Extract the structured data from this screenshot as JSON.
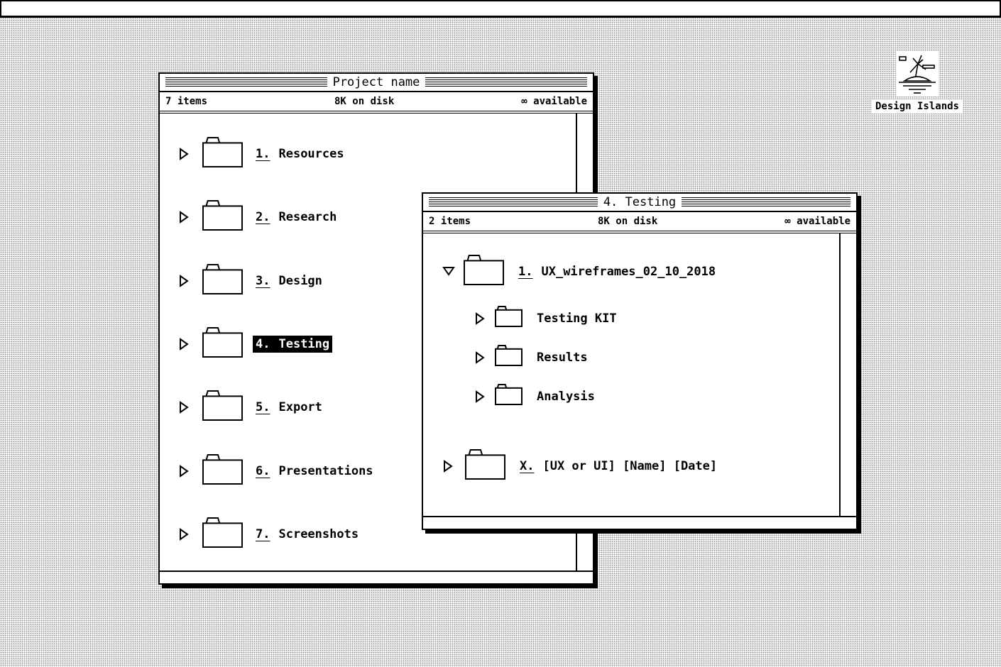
{
  "desktop": {
    "icon_label": "Design Islands",
    "icon_name": "island-icon"
  },
  "window_main": {
    "title": "Project name",
    "items_count": "7 items",
    "disk": "8K on disk",
    "available": "∞ available",
    "folders": [
      {
        "num": "1.",
        "name": "Resources"
      },
      {
        "num": "2.",
        "name": "Research"
      },
      {
        "num": "3.",
        "name": "Design"
      },
      {
        "num": "4.",
        "name": "Testing",
        "selected": true
      },
      {
        "num": "5.",
        "name": "Export"
      },
      {
        "num": "6.",
        "name": "Presentations"
      },
      {
        "num": "7.",
        "name": "Screenshots"
      }
    ]
  },
  "window_testing": {
    "title": "4. Testing",
    "items_count": "2 items",
    "disk": "8K on disk",
    "available": "∞ available",
    "folders": [
      {
        "num": "1.",
        "name": "UX_wireframes_02_10_2018",
        "expanded": true,
        "children": [
          "Testing KIT",
          "Results",
          "Analysis"
        ]
      },
      {
        "num": "X.",
        "name": "[UX or UI] [Name] [Date]",
        "expanded": false
      }
    ]
  }
}
